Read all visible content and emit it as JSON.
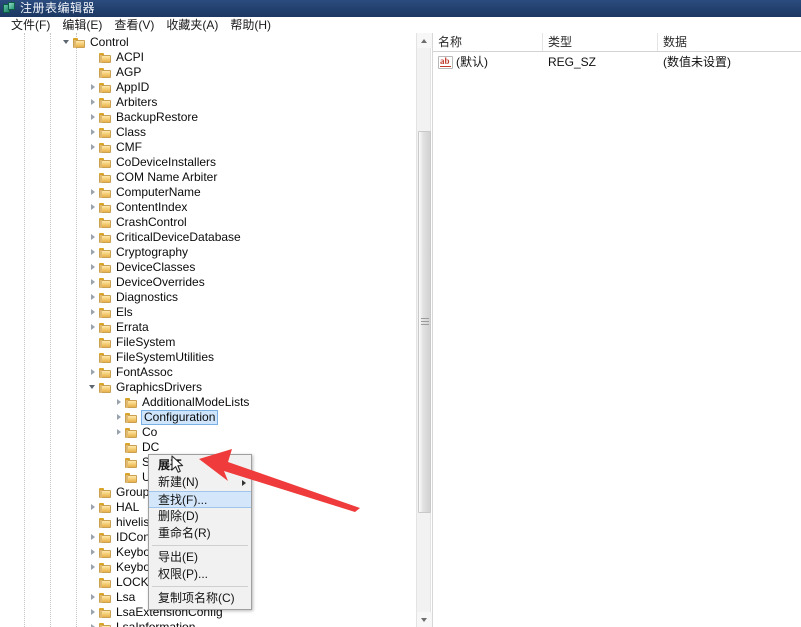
{
  "window": {
    "title": "注册表编辑器",
    "icon": "registry-icon"
  },
  "menubar": {
    "items": [
      {
        "label": "文件(F)"
      },
      {
        "label": "编辑(E)"
      },
      {
        "label": "查看(V)"
      },
      {
        "label": "收藏夹(A)"
      },
      {
        "label": "帮助(H)"
      }
    ]
  },
  "tree": {
    "rows": [
      {
        "label": "Control",
        "indent": 0,
        "twisty": "expanded",
        "selected": false
      },
      {
        "label": "ACPI",
        "indent": 1,
        "twisty": "none",
        "selected": false
      },
      {
        "label": "AGP",
        "indent": 1,
        "twisty": "none",
        "selected": false
      },
      {
        "label": "AppID",
        "indent": 1,
        "twisty": "collapsed",
        "selected": false
      },
      {
        "label": "Arbiters",
        "indent": 1,
        "twisty": "collapsed",
        "selected": false
      },
      {
        "label": "BackupRestore",
        "indent": 1,
        "twisty": "collapsed",
        "selected": false
      },
      {
        "label": "Class",
        "indent": 1,
        "twisty": "collapsed",
        "selected": false
      },
      {
        "label": "CMF",
        "indent": 1,
        "twisty": "collapsed",
        "selected": false
      },
      {
        "label": "CoDeviceInstallers",
        "indent": 1,
        "twisty": "none",
        "selected": false
      },
      {
        "label": "COM Name Arbiter",
        "indent": 1,
        "twisty": "none",
        "selected": false
      },
      {
        "label": "ComputerName",
        "indent": 1,
        "twisty": "collapsed",
        "selected": false
      },
      {
        "label": "ContentIndex",
        "indent": 1,
        "twisty": "collapsed",
        "selected": false
      },
      {
        "label": "CrashControl",
        "indent": 1,
        "twisty": "none",
        "selected": false
      },
      {
        "label": "CriticalDeviceDatabase",
        "indent": 1,
        "twisty": "collapsed",
        "selected": false
      },
      {
        "label": "Cryptography",
        "indent": 1,
        "twisty": "collapsed",
        "selected": false
      },
      {
        "label": "DeviceClasses",
        "indent": 1,
        "twisty": "collapsed",
        "selected": false
      },
      {
        "label": "DeviceOverrides",
        "indent": 1,
        "twisty": "collapsed",
        "selected": false
      },
      {
        "label": "Diagnostics",
        "indent": 1,
        "twisty": "collapsed",
        "selected": false
      },
      {
        "label": "Els",
        "indent": 1,
        "twisty": "collapsed",
        "selected": false
      },
      {
        "label": "Errata",
        "indent": 1,
        "twisty": "collapsed",
        "selected": false
      },
      {
        "label": "FileSystem",
        "indent": 1,
        "twisty": "none",
        "selected": false
      },
      {
        "label": "FileSystemUtilities",
        "indent": 1,
        "twisty": "none",
        "selected": false
      },
      {
        "label": "FontAssoc",
        "indent": 1,
        "twisty": "collapsed",
        "selected": false
      },
      {
        "label": "GraphicsDrivers",
        "indent": 1,
        "twisty": "expanded",
        "selected": false
      },
      {
        "label": "AdditionalModeLists",
        "indent": 2,
        "twisty": "collapsed",
        "selected": false
      },
      {
        "label": "Configuration",
        "indent": 2,
        "twisty": "collapsed",
        "selected": true
      },
      {
        "label": "Co",
        "indent": 2,
        "twisty": "collapsed",
        "selected": false
      },
      {
        "label": "DC",
        "indent": 2,
        "twisty": "none",
        "selected": false
      },
      {
        "label": "Scl",
        "indent": 2,
        "twisty": "none",
        "selected": false
      },
      {
        "label": "Us",
        "indent": 2,
        "twisty": "none",
        "selected": false
      },
      {
        "label": "Group",
        "indent": 1,
        "twisty": "none",
        "selected": false
      },
      {
        "label": "HAL",
        "indent": 1,
        "twisty": "collapsed",
        "selected": false
      },
      {
        "label": "hivelis",
        "indent": 1,
        "twisty": "none",
        "selected": false
      },
      {
        "label": "IDCon",
        "indent": 1,
        "twisty": "collapsed",
        "selected": false
      },
      {
        "label": "Keyboard Layout",
        "indent": 1,
        "twisty": "collapsed",
        "selected": false
      },
      {
        "label": "Keyboard Layouts",
        "indent": 1,
        "twisty": "collapsed",
        "selected": false
      },
      {
        "label": "LOCKSDK",
        "indent": 1,
        "twisty": "none",
        "selected": false
      },
      {
        "label": "Lsa",
        "indent": 1,
        "twisty": "collapsed",
        "selected": false
      },
      {
        "label": "LsaExtensionConfig",
        "indent": 1,
        "twisty": "collapsed",
        "selected": false
      },
      {
        "label": "LsaInformation",
        "indent": 1,
        "twisty": "collapsed",
        "selected": false
      }
    ]
  },
  "scrollbar": {
    "up_arrow": "scroll-up-arrow",
    "down_arrow": "scroll-down-arrow"
  },
  "value_list": {
    "columns": [
      {
        "label": "名称"
      },
      {
        "label": "类型"
      },
      {
        "label": "数据"
      }
    ],
    "rows": [
      {
        "icon": "string-value-icon",
        "name": "(默认)",
        "type": "REG_SZ",
        "data": "(数值未设置)"
      }
    ]
  },
  "context_menu": {
    "items": [
      {
        "label": "展开",
        "bold": true,
        "highlight": false,
        "submenu": false,
        "separator_after": false
      },
      {
        "label": "新建(N)",
        "bold": false,
        "highlight": false,
        "submenu": true,
        "separator_after": false
      },
      {
        "label": "查找(F)...",
        "bold": false,
        "highlight": true,
        "submenu": false,
        "separator_after": false
      },
      {
        "label": "删除(D)",
        "bold": false,
        "highlight": false,
        "submenu": false,
        "separator_after": false
      },
      {
        "label": "重命名(R)",
        "bold": false,
        "highlight": false,
        "submenu": false,
        "separator_after": true
      },
      {
        "label": "导出(E)",
        "bold": false,
        "highlight": false,
        "submenu": false,
        "separator_after": false
      },
      {
        "label": "权限(P)...",
        "bold": false,
        "highlight": false,
        "submenu": false,
        "separator_after": true
      },
      {
        "label": "复制项名称(C)",
        "bold": false,
        "highlight": false,
        "submenu": false,
        "separator_after": false
      }
    ]
  },
  "annotation": {
    "arrow_color": "#ef3b3b",
    "name": "red-pointer-arrow"
  },
  "colors": {
    "titlebar": "#22406e",
    "selection": "#cfe5fb",
    "menu_highlight": "#d4e7fa",
    "folder": "#f6d07a"
  }
}
